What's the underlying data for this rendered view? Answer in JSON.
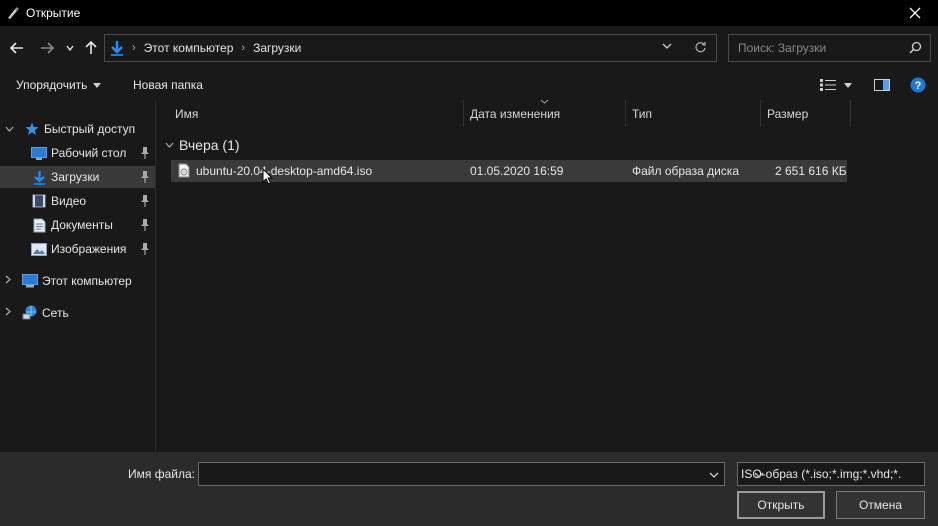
{
  "window": {
    "title": "Открытие"
  },
  "address": {
    "crumbs": [
      "Этот компьютер",
      "Загрузки"
    ]
  },
  "search": {
    "placeholder": "Поиск: Загрузки"
  },
  "toolbar": {
    "organize_label": "Упорядочить",
    "new_folder_label": "Новая папка"
  },
  "sidebar": {
    "quick_access": "Быстрый доступ",
    "items": [
      {
        "label": "Рабочий стол",
        "icon": "desktop-icon",
        "pinned": true,
        "selected": false
      },
      {
        "label": "Загрузки",
        "icon": "downloads-icon",
        "pinned": true,
        "selected": true
      },
      {
        "label": "Видео",
        "icon": "video-icon",
        "pinned": true,
        "selected": false
      },
      {
        "label": "Документы",
        "icon": "documents-icon",
        "pinned": true,
        "selected": false
      },
      {
        "label": "Изображения",
        "icon": "pictures-icon",
        "pinned": true,
        "selected": false
      }
    ],
    "this_pc": "Этот компьютер",
    "network": "Сеть"
  },
  "columns": [
    "Имя",
    "Дата изменения",
    "Тип",
    "Размер"
  ],
  "group": {
    "label": "Вчера (1)"
  },
  "files": [
    {
      "name": "ubuntu-20.04-desktop-amd64.iso",
      "date": "01.05.2020 16:59",
      "type": "Файл образа диска",
      "size": "2 651 616 КБ"
    }
  ],
  "footer": {
    "filename_label": "Имя файла:",
    "filename_value": "",
    "filter_value": "ISO-образ (*.iso;*.img;*.vhd;*.",
    "open_label": "Открыть",
    "cancel_label": "Отмена"
  },
  "colors": {
    "accent": "#1e90ff",
    "selected_bg": "#393939",
    "help": "#1e78d7"
  }
}
